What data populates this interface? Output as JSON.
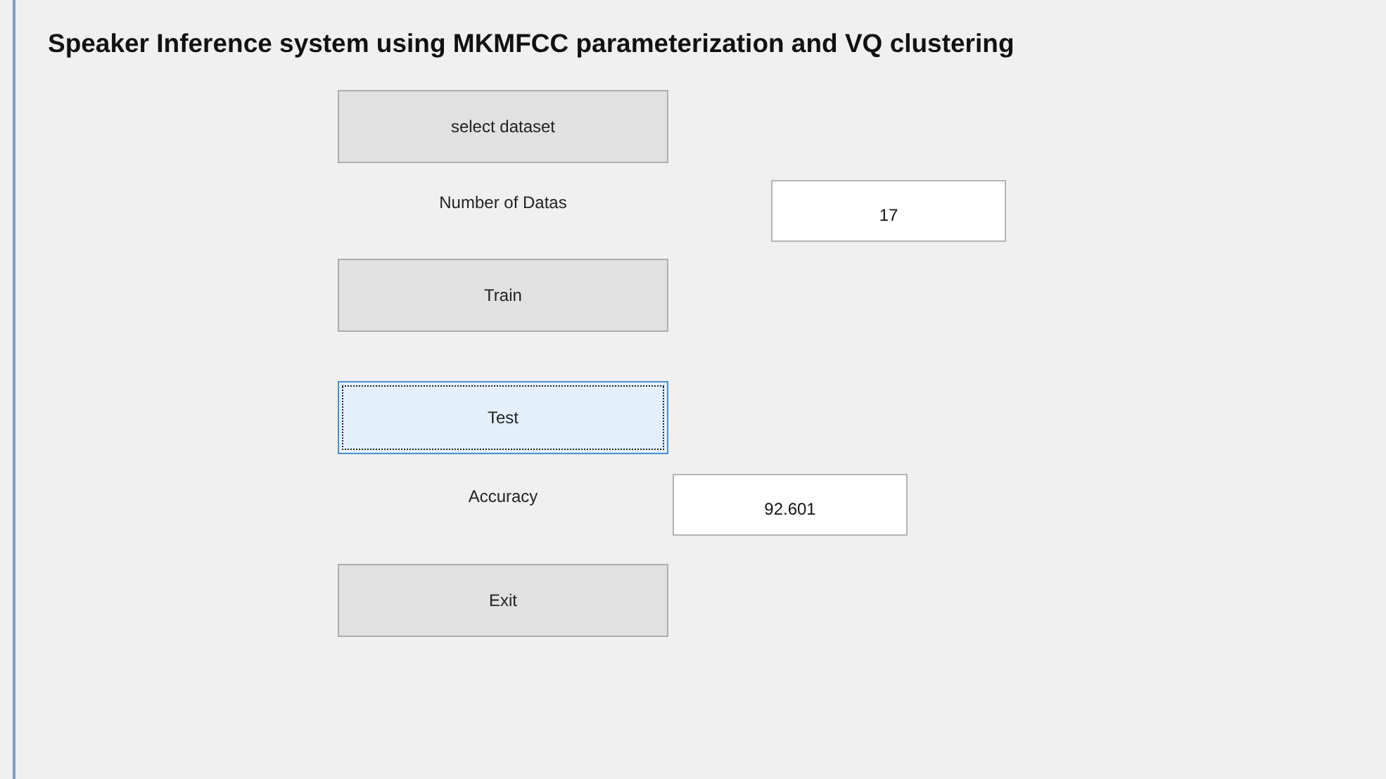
{
  "title": "Speaker Inference system using MKMFCC parameterization and VQ clustering",
  "controls": [
    {
      "kind": "button",
      "label": "select dataset",
      "focused": false
    },
    {
      "kind": "readout",
      "label": "Number of Datas",
      "value": "17"
    },
    {
      "kind": "button",
      "label": "Train",
      "focused": false
    },
    {
      "kind": "button",
      "label": "Test",
      "focused": true
    },
    {
      "kind": "readout",
      "label": "Accuracy",
      "value": "92.601"
    },
    {
      "kind": "button",
      "label": "Exit",
      "focused": false
    }
  ]
}
